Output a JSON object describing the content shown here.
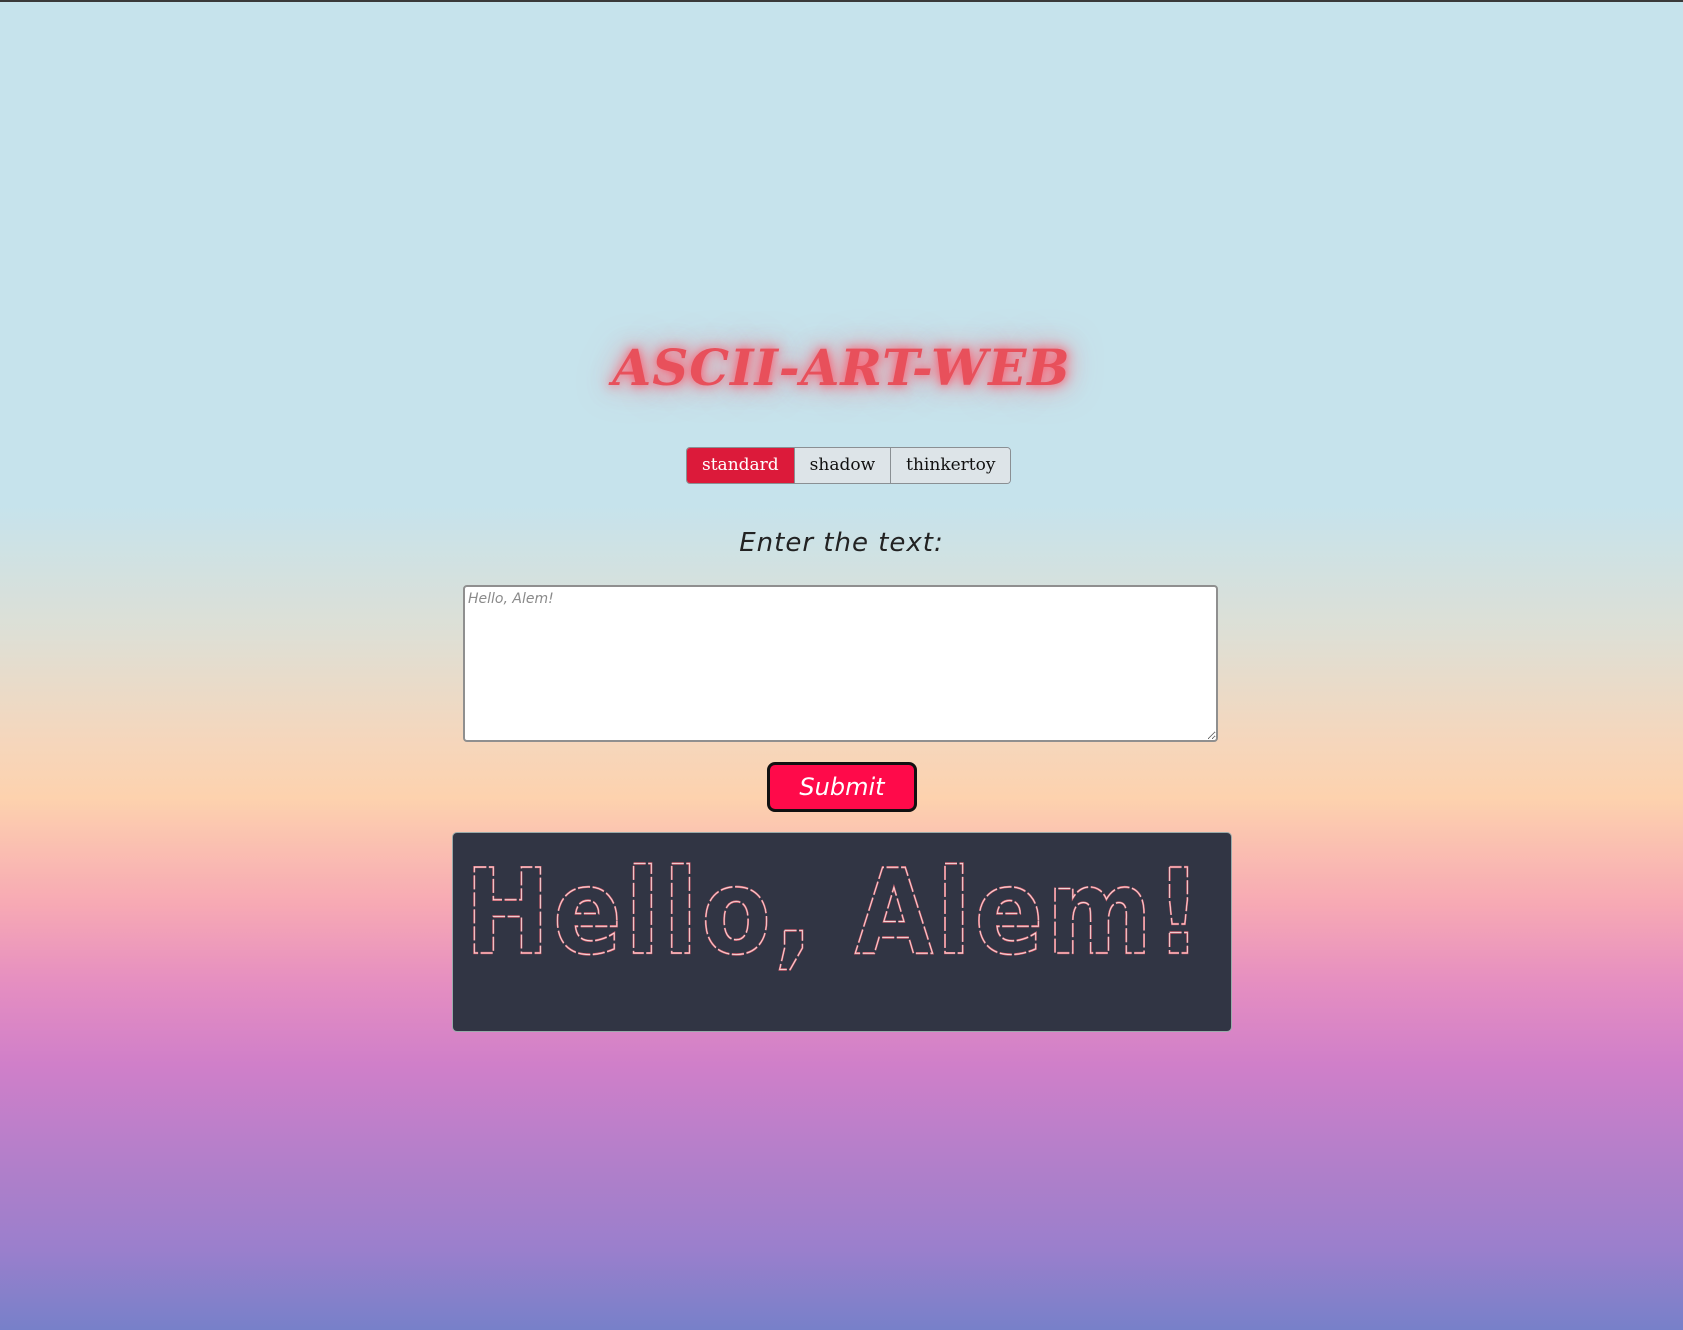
{
  "title": "ASCII-ART-WEB",
  "banners": [
    {
      "label": "standard",
      "active": true
    },
    {
      "label": "shadow",
      "active": false
    },
    {
      "label": "thinkertoy",
      "active": false
    }
  ],
  "prompt": "Enter the text:",
  "input": {
    "value": "",
    "placeholder": "Hello, Alem!"
  },
  "submit_label": "Submit",
  "output": {
    "text": "Hello, Alem!"
  },
  "colors": {
    "title": "#e8505b",
    "active_button": "#dc1a3a",
    "submit": "#ff0a4a",
    "output_bg": "#313544",
    "ascii_stroke": "#e86d7a"
  }
}
